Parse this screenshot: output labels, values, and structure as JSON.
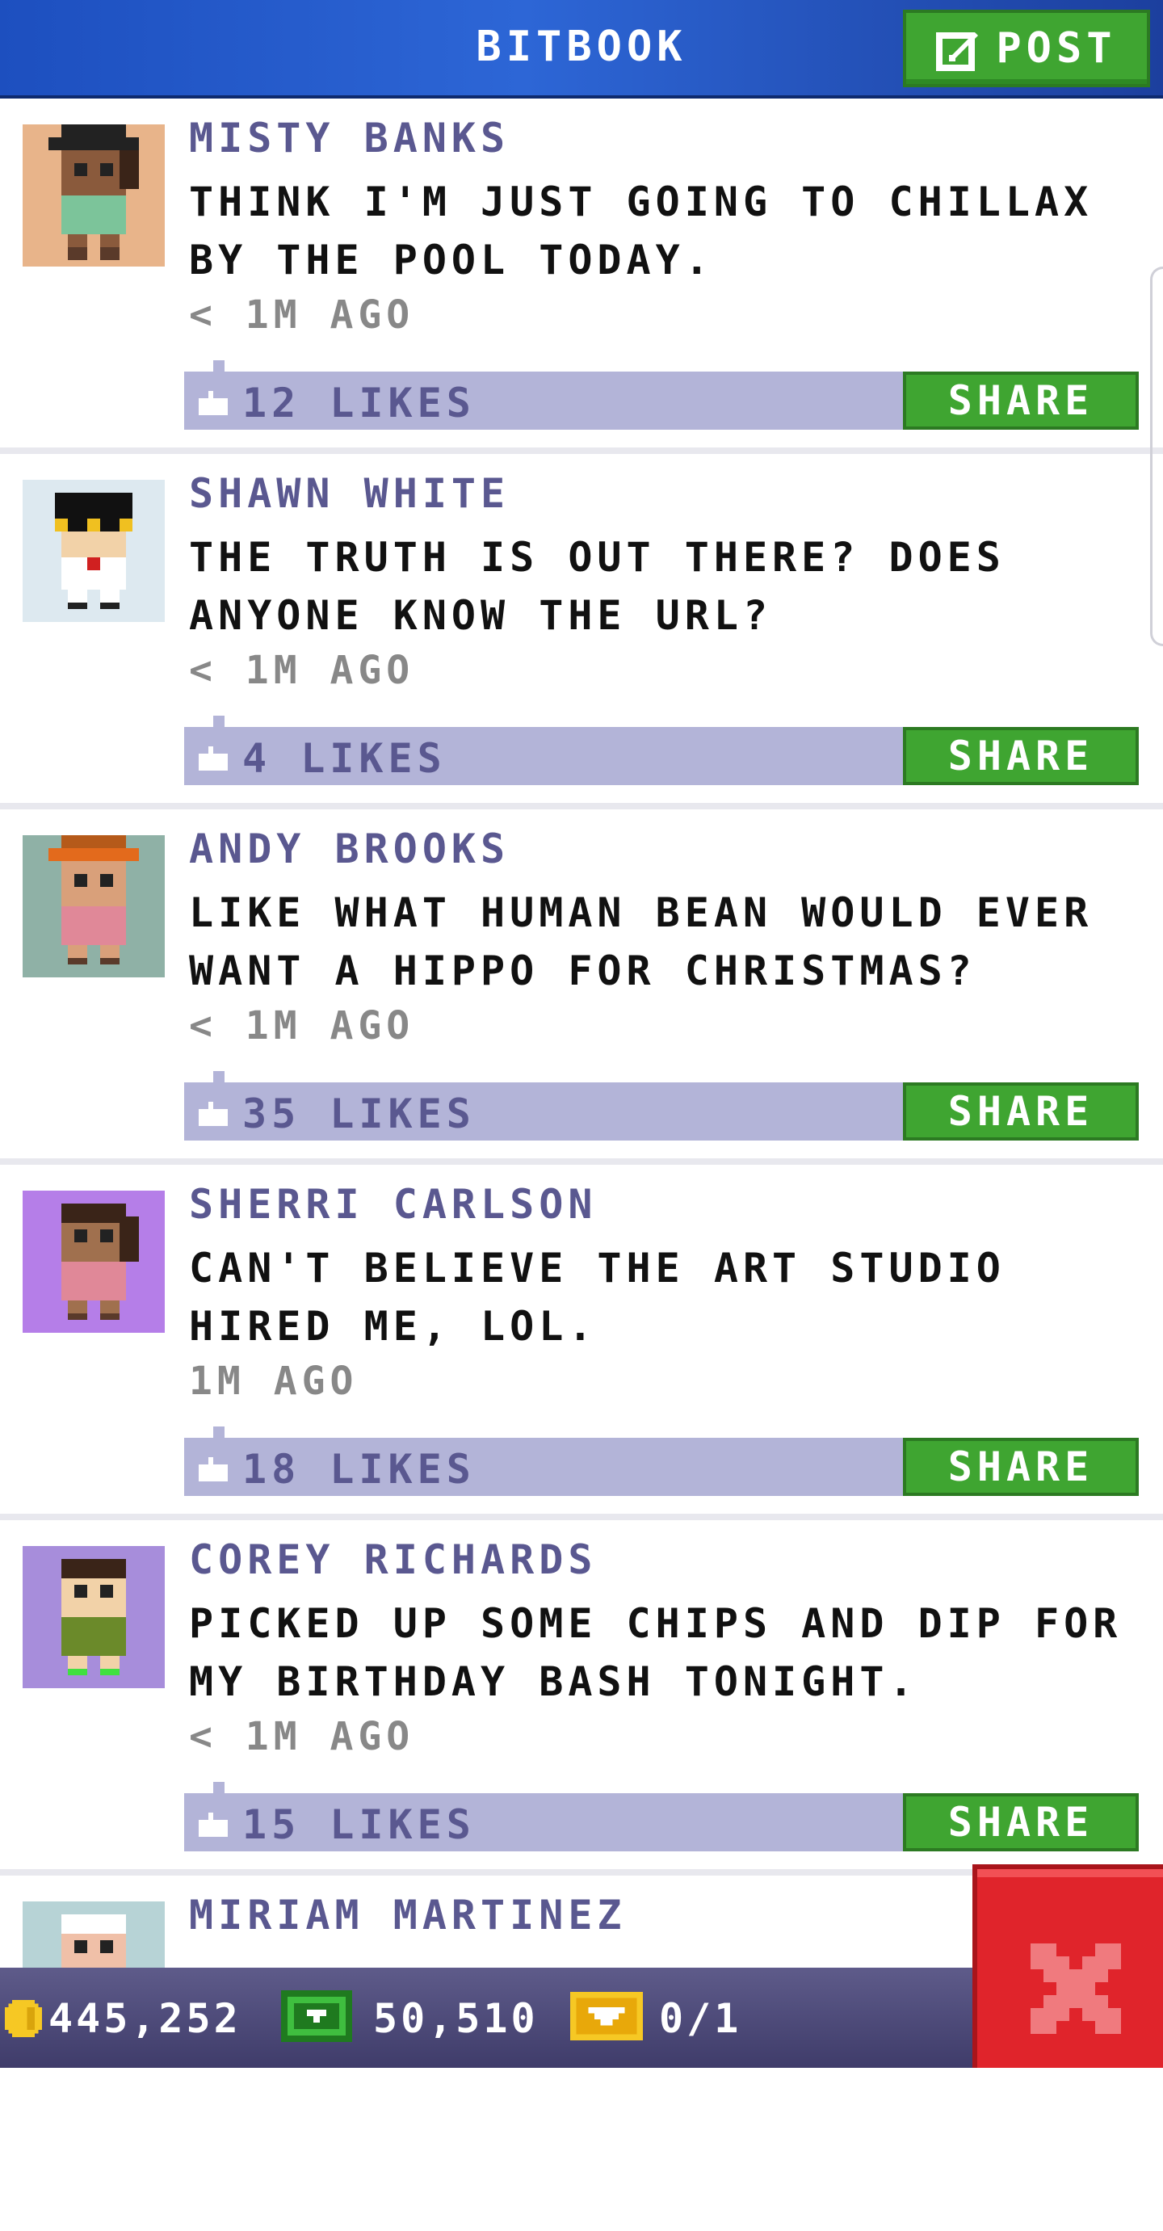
{
  "header": {
    "title": "BITBOOK",
    "post_label": "POST"
  },
  "posts": [
    {
      "author": "MISTY BANKS",
      "text": "THINK I'M JUST GOING TO CHILLAX BY THE POOL TODAY.",
      "time": "< 1M AGO",
      "likes": "12 LIKES",
      "share": "SHARE",
      "avatar_bg": "#e8b48a"
    },
    {
      "author": "SHAWN WHITE",
      "text": "THE TRUTH IS OUT THERE? DOES ANYONE KNOW THE URL?",
      "time": "< 1M AGO",
      "likes": "4 LIKES",
      "share": "SHARE",
      "avatar_bg": "#dde9f0"
    },
    {
      "author": "ANDY BROOKS",
      "text": "LIKE WHAT HUMAN BEAN WOULD EVER WANT A HIPPO FOR CHRISTMAS?",
      "time": "< 1M AGO",
      "likes": "35 LIKES",
      "share": "SHARE",
      "avatar_bg": "#8fb1a6"
    },
    {
      "author": "SHERRI CARLSON",
      "text": "CAN'T BELIEVE THE ART STUDIO HIRED ME, LOL.",
      "time": "1M AGO",
      "likes": "18 LIKES",
      "share": "SHARE",
      "avatar_bg": "#b57ee8"
    },
    {
      "author": "COREY RICHARDS",
      "text": "PICKED UP SOME CHIPS AND DIP FOR MY BIRTHDAY BASH TONIGHT.",
      "time": "< 1M AGO",
      "likes": "15 LIKES",
      "share": "SHARE",
      "avatar_bg": "#a78ddb"
    },
    {
      "author": "MIRIAM MARTINEZ",
      "text": "",
      "time": "",
      "likes": "",
      "share": "",
      "avatar_bg": "#b7d3d6"
    }
  ],
  "bottom_bar": {
    "coins": "445,252",
    "bux": "50,510",
    "tickets": "0/1"
  },
  "colors": {
    "header_blue": "#2d66d6",
    "share_green": "#3fa531",
    "like_bar": "#b3b4d8",
    "author_purple": "#5a5890",
    "close_red": "#e0242b"
  },
  "icons": [
    "post-edit-icon",
    "like-hand-icon",
    "coin-icon",
    "cash-icon",
    "ticket-icon",
    "close-icon"
  ]
}
